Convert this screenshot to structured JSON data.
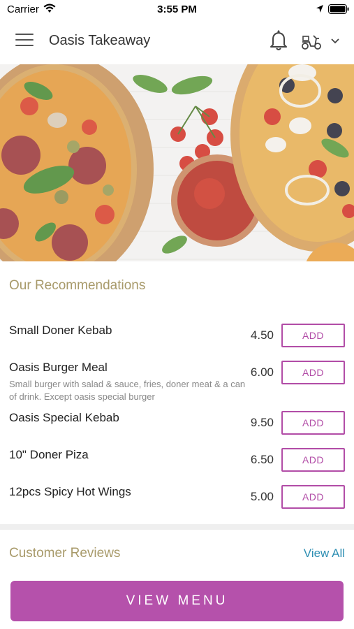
{
  "status_bar": {
    "carrier": "Carrier",
    "time": "3:55 PM"
  },
  "header": {
    "title": "Oasis Takeaway",
    "icons": [
      "menu-icon",
      "bell-icon",
      "scooter-icon",
      "chevron-down-icon"
    ]
  },
  "hero": {
    "icon": "pizza-hero-image"
  },
  "recommendations": {
    "title": "Our Recommendations",
    "items": [
      {
        "name": "Small Doner Kebab",
        "description": "",
        "price": "4.50",
        "button": "ADD"
      },
      {
        "name": "Oasis Burger Meal",
        "description": "Small burger with salad & sauce, fries, doner meat & a can of drink. Except oasis special burger",
        "price": "6.00",
        "button": "ADD"
      },
      {
        "name": "Oasis Special Kebab",
        "description": "",
        "price": "9.50",
        "button": "ADD"
      },
      {
        "name": "10\" Doner Piza",
        "description": "",
        "price": "6.50",
        "button": "ADD"
      },
      {
        "name": "12pcs Spicy Hot Wings",
        "description": "",
        "price": "5.00",
        "button": "ADD"
      }
    ]
  },
  "reviews": {
    "title": "Customer Reviews",
    "view_all": "View All"
  },
  "footer": {
    "view_menu": "VIEW MENU"
  },
  "colors": {
    "accent": "#b551ab",
    "section_title": "#a89a6a",
    "link": "#2e8fb3"
  }
}
